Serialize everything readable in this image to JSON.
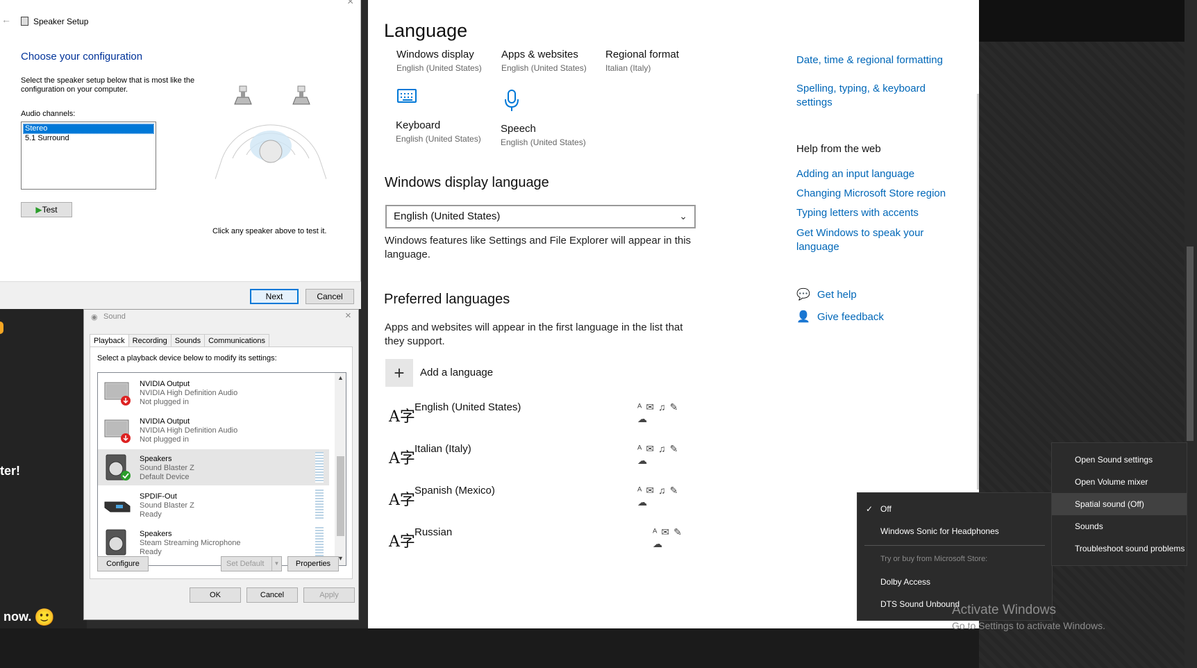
{
  "left_chat": {
    "fragment1": "ter!",
    "fragment2": "now.",
    "emoji": "🙂"
  },
  "speaker_setup": {
    "title": "Speaker Setup",
    "heading": "Choose your configuration",
    "description": "Select the speaker setup below that is most like the configuration on your computer.",
    "audio_channels_label": "Audio channels:",
    "channels": [
      "Stereo",
      "5.1 Surround"
    ],
    "selected_channel": "Stereo",
    "test_button": "Test",
    "hint": "Click any speaker above to test it.",
    "next_button": "Next",
    "cancel_button": "Cancel"
  },
  "sound_dialog": {
    "title": "Sound",
    "tabs": [
      "Playback",
      "Recording",
      "Sounds",
      "Communications"
    ],
    "active_tab": "Playback",
    "instruction": "Select a playback device below to modify its settings:",
    "devices": [
      {
        "name": "NVIDIA Output",
        "driver": "NVIDIA High Definition Audio",
        "status": "Not plugged in"
      },
      {
        "name": "NVIDIA Output",
        "driver": "NVIDIA High Definition Audio",
        "status": "Not plugged in"
      },
      {
        "name": "Speakers",
        "driver": "Sound Blaster Z",
        "status": "Default Device"
      },
      {
        "name": "SPDIF-Out",
        "driver": "Sound Blaster Z",
        "status": "Ready"
      },
      {
        "name": "Speakers",
        "driver": "Steam Streaming Microphone",
        "status": "Ready"
      }
    ],
    "configure_button": "Configure",
    "set_default_button": "Set Default",
    "properties_button": "Properties",
    "ok_button": "OK",
    "cancel_button": "Cancel",
    "apply_button": "Apply"
  },
  "settings": {
    "title": "Language",
    "tiles": [
      {
        "label": "Windows display",
        "value": "English (United States)"
      },
      {
        "label": "Apps & websites",
        "value": "English (United States)"
      },
      {
        "label": "Regional format",
        "value": "Italian (Italy)"
      },
      {
        "label": "Keyboard",
        "value": "English (United States)"
      },
      {
        "label": "Speech",
        "value": "English (United States)"
      }
    ],
    "display_language_heading": "Windows display language",
    "display_language_value": "English (United States)",
    "display_language_desc": "Windows features like Settings and File Explorer will appear in this language.",
    "preferred_heading": "Preferred languages",
    "preferred_desc": "Apps and websites will appear in the first language in the list that they support.",
    "add_language": "Add a language",
    "languages": [
      "English (United States)",
      "Italian (Italy)",
      "Spanish (Mexico)",
      "Russian"
    ],
    "related_links": [
      "Date, time & regional formatting",
      "Spelling, typing, & keyboard settings"
    ],
    "help_heading": "Help from the web",
    "help_links": [
      "Adding an input language",
      "Changing Microsoft Store region",
      "Typing letters with accents",
      "Get Windows to speak your language"
    ],
    "get_help": "Get help",
    "give_feedback": "Give feedback"
  },
  "spatial_menu": {
    "items": [
      "Off",
      "Windows Sonic for Headphones"
    ],
    "checked": "Off",
    "store_label": "Try or buy from Microsoft Store:",
    "store_items": [
      "Dolby Access",
      "DTS Sound Unbound"
    ]
  },
  "tray_menu": {
    "items": [
      "Open Sound settings",
      "Open Volume mixer",
      "Spatial sound (Off)",
      "Sounds",
      "Troubleshoot sound problems"
    ],
    "highlighted": "Spatial sound (Off)"
  },
  "watermark": {
    "title": "Activate Windows",
    "subtitle": "Go to Settings to activate Windows."
  },
  "colors": {
    "accent": "#0078d7",
    "link": "#0067b8",
    "menu_bg": "#2b2b2b"
  }
}
